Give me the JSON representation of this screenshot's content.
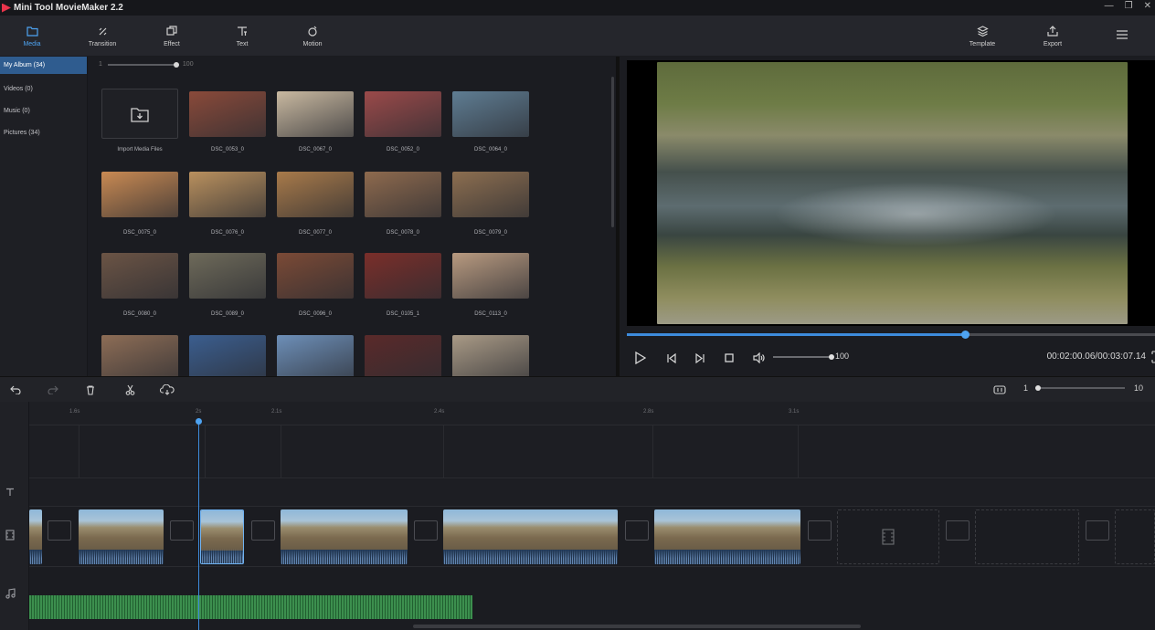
{
  "app": {
    "title": "Mini Tool MovieMaker 2.2",
    "accent": "#4ea3f1"
  },
  "window_controls": {
    "minimize": "—",
    "maximize": "❐",
    "close": "✕"
  },
  "toolbar": {
    "tabs": [
      {
        "label": "Media",
        "icon": "folder-icon",
        "active": true
      },
      {
        "label": "Transition",
        "icon": "transition-icon"
      },
      {
        "label": "Effect",
        "icon": "effect-icon"
      },
      {
        "label": "Text",
        "icon": "text-icon"
      },
      {
        "label": "Motion",
        "icon": "motion-icon"
      }
    ],
    "template_label": "Template",
    "export_label": "Export",
    "menu_icon": "hamburger-menu-icon"
  },
  "library": {
    "items": [
      {
        "label": "My Album  (34)",
        "active": true
      },
      {
        "label": "Videos  (0)"
      },
      {
        "label": "Music  (0)"
      },
      {
        "label": "Pictures  (34)"
      }
    ]
  },
  "media": {
    "zoom_min": "1",
    "zoom_max": "100",
    "import_label": "Import Media Files",
    "items": [
      {
        "name": "DSC_0053_0",
        "color": "#8a4a3a"
      },
      {
        "name": "DSC_0067_0",
        "color": "#c9b9a1"
      },
      {
        "name": "DSC_0052_0",
        "color": "#9b4a4a"
      },
      {
        "name": "DSC_0064_0",
        "color": "#5f7d93"
      },
      {
        "name": "DSC_0075_0",
        "color": "#c98a53"
      },
      {
        "name": "DSC_0076_0",
        "color": "#b9905e"
      },
      {
        "name": "DSC_0077_0",
        "color": "#a87a4a"
      },
      {
        "name": "DSC_0078_0",
        "color": "#8e6a4e"
      },
      {
        "name": "DSC_0079_0",
        "color": "#8c6e50"
      },
      {
        "name": "DSC_0080_0",
        "color": "#6b5445"
      },
      {
        "name": "DSC_0089_0",
        "color": "#6e6a5a"
      },
      {
        "name": "DSC_0096_0",
        "color": "#7b4a36"
      },
      {
        "name": "DSC_0105_1",
        "color": "#7a2e2a"
      },
      {
        "name": "DSC_0113_0",
        "color": "#b89a80"
      },
      {
        "name": "",
        "color": "#8d6d56"
      },
      {
        "name": "",
        "color": "#3b5e8f"
      },
      {
        "name": "",
        "color": "#6d8fb8"
      },
      {
        "name": "",
        "color": "#5a2a2a"
      },
      {
        "name": "",
        "color": "#a99a86"
      }
    ]
  },
  "preview": {
    "progress": 0.64,
    "volume": "100",
    "timecode": "00:02:00.06/00:03:07.14",
    "fullscreen_icon": "fullscreen-icon"
  },
  "timeline_toolbar": {
    "zoom_min": "1",
    "zoom_max": "10"
  },
  "timeline": {
    "ticks": [
      "1.6s",
      "2s",
      "2.1s",
      "2.4s",
      "2.8s",
      "3.1s"
    ]
  }
}
